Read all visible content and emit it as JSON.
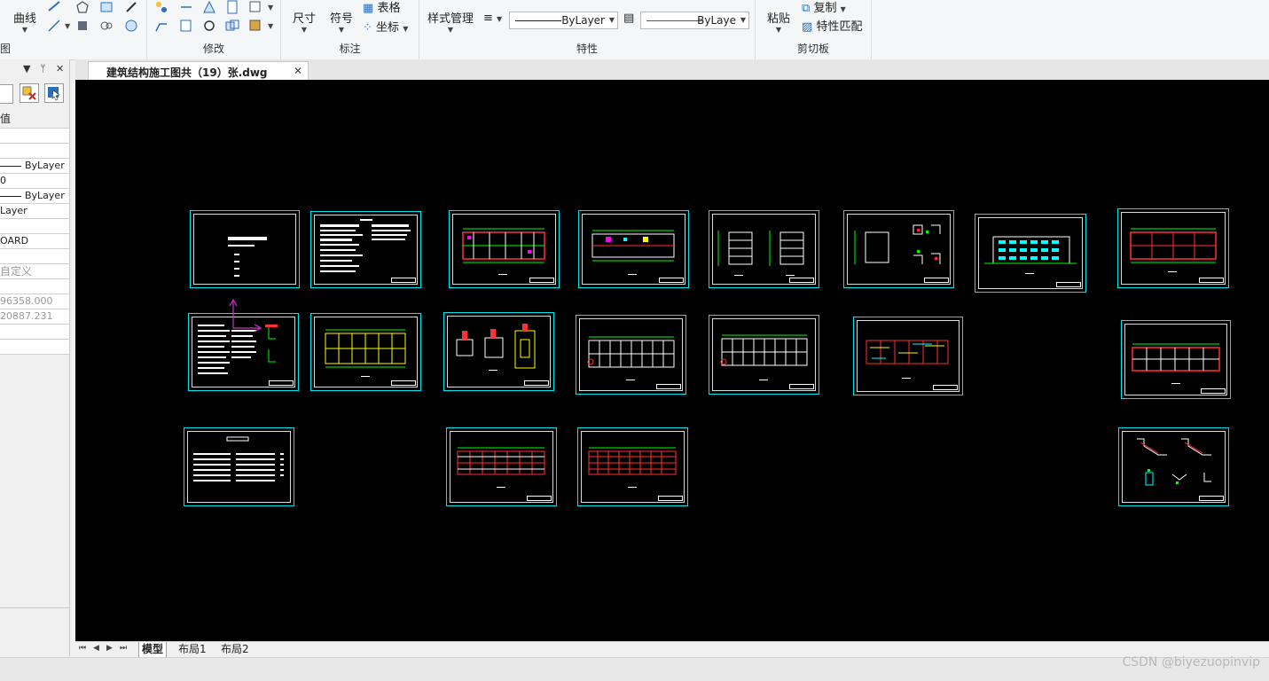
{
  "ribbon": {
    "draw": {
      "curve_label": "曲线",
      "group_label": "图"
    },
    "modify": {
      "group_label": "修改"
    },
    "annotate": {
      "dimension_label": "尺寸",
      "symbol_label": "符号",
      "table_label": "表格",
      "coord_label": "坐标",
      "group_label": "标注"
    },
    "properties": {
      "style_manager_label": "样式管理",
      "linetype_value": "ByLayer",
      "lineweight_value": "ByLaye",
      "group_label": "特性"
    },
    "clipboard": {
      "paste_label": "粘贴",
      "copy_label": "复制",
      "match_label": "特性匹配",
      "group_label": "剪切板"
    }
  },
  "panel": {
    "header_value_label": "值",
    "rows": [
      "ByLayer",
      "0",
      "ByLayer",
      "Layer",
      "OARD",
      "自定义",
      "96358.000",
      "20887.231"
    ]
  },
  "document": {
    "tab_title": "建筑结构施工图共（19）张.dwg"
  },
  "layout_tabs": [
    "模型",
    "布局1",
    "布局2"
  ],
  "watermark": "CSDN @biyezuopinvip",
  "colors": {
    "sheet_frame": "#00e5ee",
    "canvas_bg": "#000000",
    "ucs_axis": "#cc33cc",
    "ribbon_bg": "#f5f6f7"
  }
}
